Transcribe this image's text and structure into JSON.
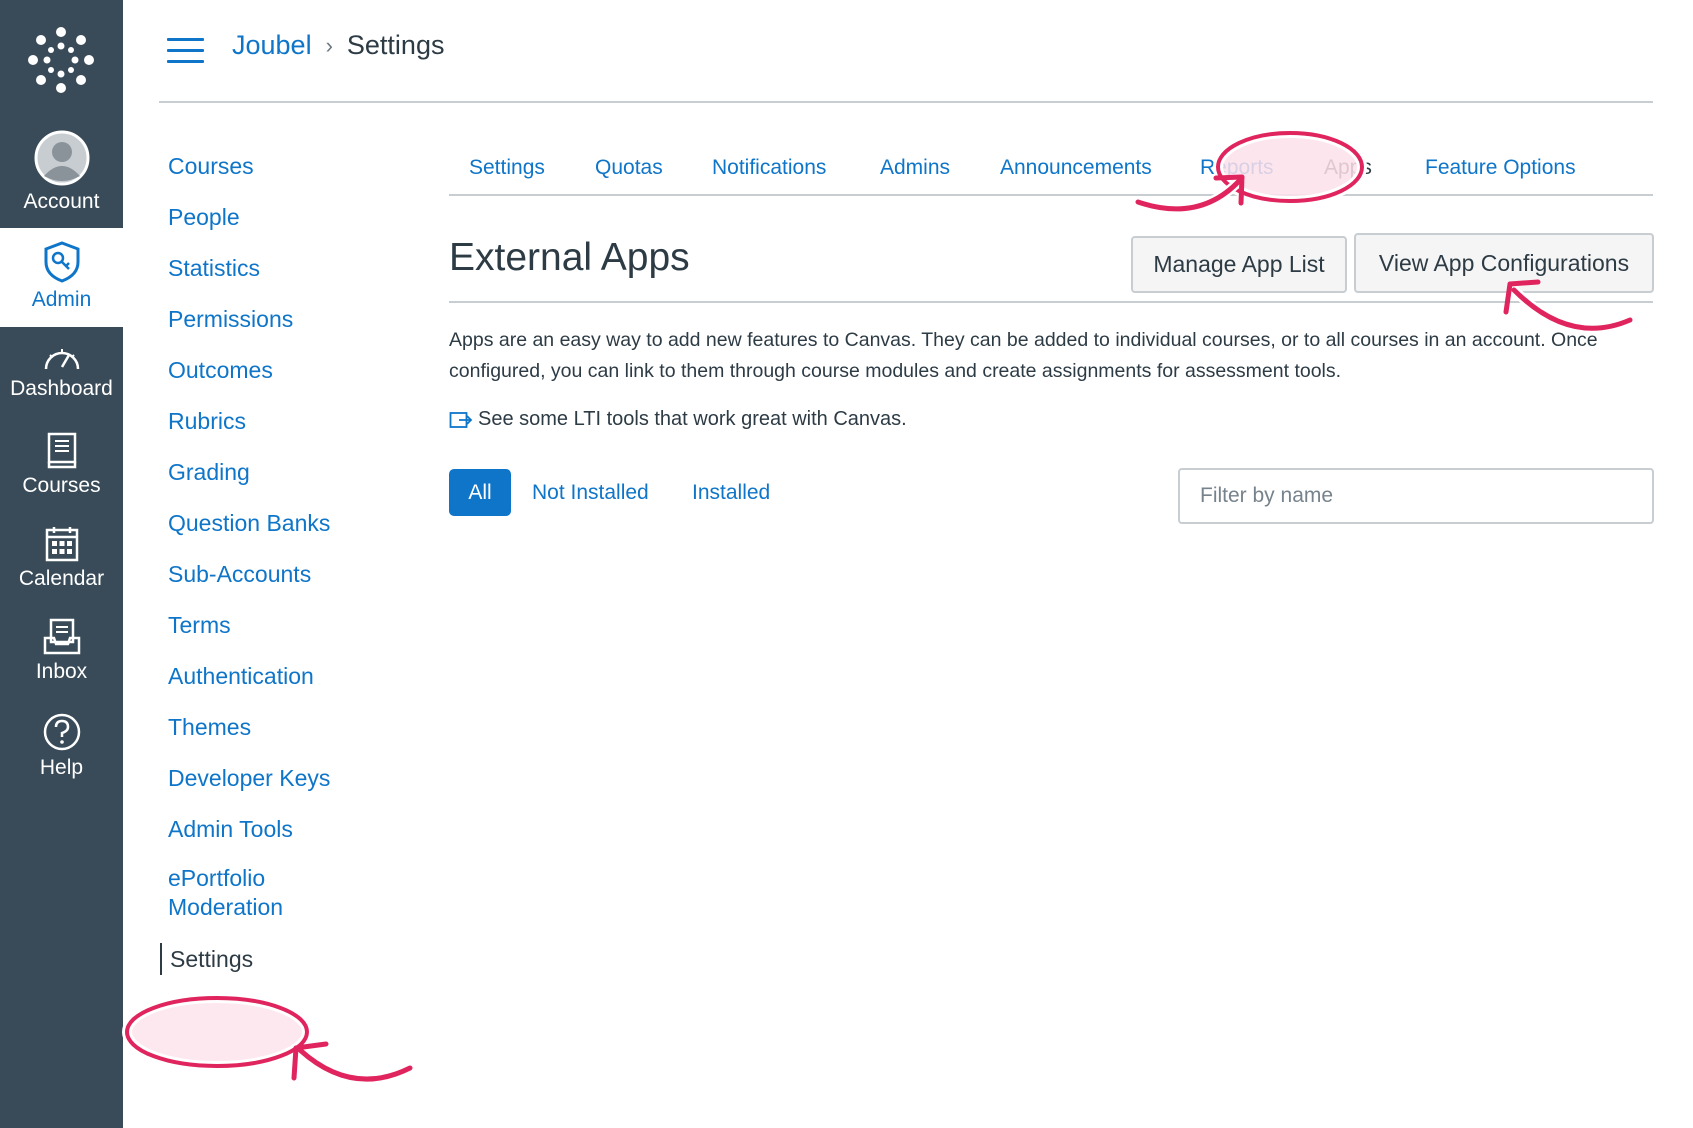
{
  "global_nav": {
    "account": "Account",
    "admin": "Admin",
    "dashboard": "Dashboard",
    "courses": "Courses",
    "calendar": "Calendar",
    "inbox": "Inbox",
    "help": "Help"
  },
  "header": {
    "breadcrumb_root": "Joubel",
    "breadcrumb_current": "Settings",
    "separator": "›"
  },
  "section_menu": [
    "Courses",
    "People",
    "Statistics",
    "Permissions",
    "Outcomes",
    "Rubrics",
    "Grading",
    "Question Banks",
    "Sub-Accounts",
    "Terms",
    "Authentication",
    "Themes",
    "Developer Keys",
    "Admin Tools",
    "ePortfolio Moderation",
    "Settings"
  ],
  "tabs": [
    "Settings",
    "Quotas",
    "Notifications",
    "Admins",
    "Announcements",
    "Reports",
    "Apps",
    "Feature Options"
  ],
  "content": {
    "title": "External Apps",
    "manage_button": "Manage App List",
    "view_config_button": "View App Configurations",
    "description": "Apps are an easy way to add new features to Canvas. They can be added to individual courses, or to all courses in an account. Once configured, you can link to them through course modules and create assignments for assessment tools.",
    "lti_link": "See some LTI tools that work great with Canvas.",
    "filter_all": "All",
    "filter_not_installed": "Not Installed",
    "filter_installed": "Installed",
    "filter_placeholder": "Filter by name"
  },
  "colors": {
    "nav_bg": "#394b58",
    "link": "#0e75c9",
    "text": "#2d3b45",
    "annotation": "#e0245e",
    "annotation_fill": "#fde0ea"
  }
}
